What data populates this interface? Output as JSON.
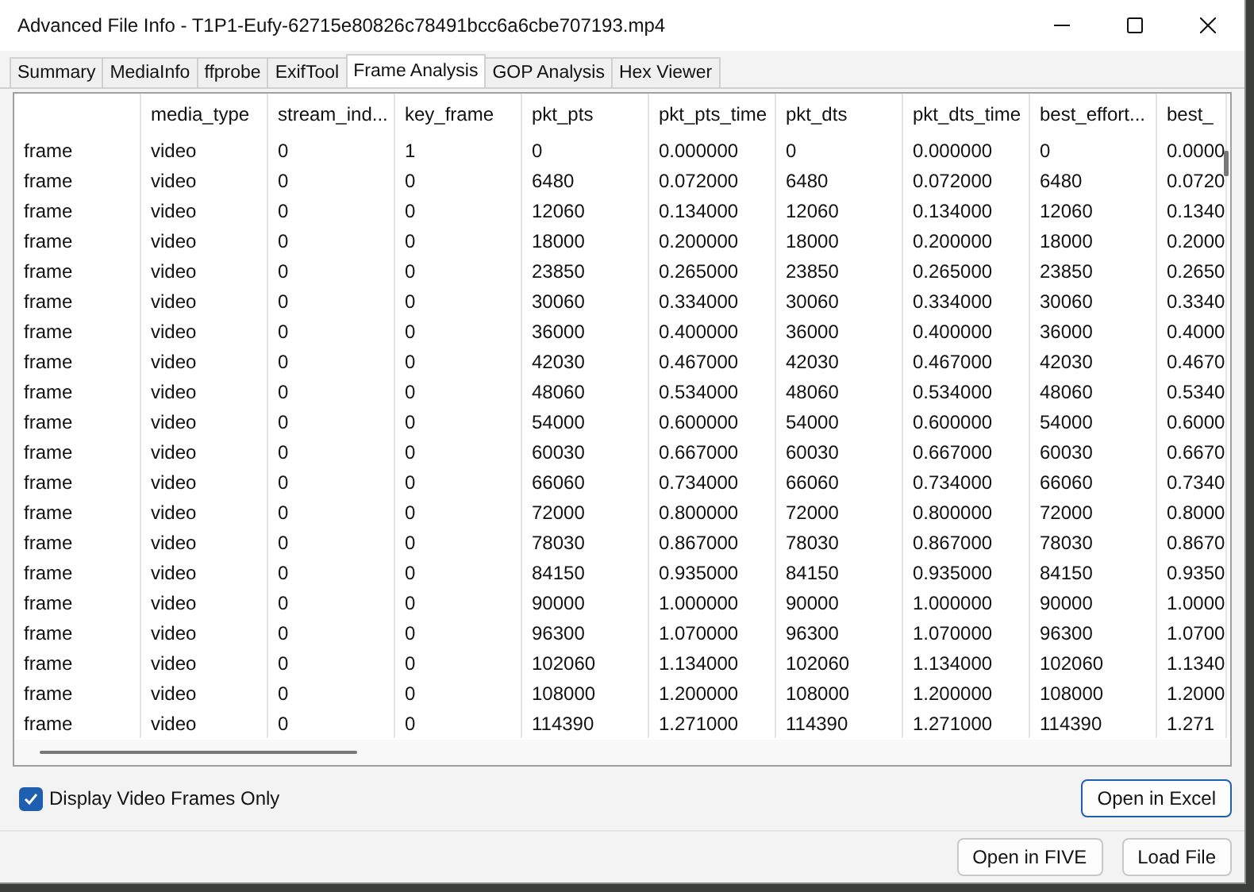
{
  "window": {
    "title": "Advanced File Info - T1P1-Eufy-62715e80826c78491bcc6a6cbe707193.mp4"
  },
  "tabs": [
    {
      "label": "Summary",
      "selected": false
    },
    {
      "label": "MediaInfo",
      "selected": false
    },
    {
      "label": "ffprobe",
      "selected": false
    },
    {
      "label": "ExifTool",
      "selected": false
    },
    {
      "label": "Frame Analysis",
      "selected": true
    },
    {
      "label": "GOP Analysis",
      "selected": false
    },
    {
      "label": "Hex Viewer",
      "selected": false
    }
  ],
  "table": {
    "columns": [
      "",
      "media_type",
      "stream_ind...",
      "key_frame",
      "pkt_pts",
      "pkt_pts_time",
      "pkt_dts",
      "pkt_dts_time",
      "best_effort...",
      "best_"
    ],
    "rows": [
      [
        "frame",
        "video",
        "0",
        "1",
        "0",
        "0.000000",
        "0",
        "0.000000",
        "0",
        "0.0000"
      ],
      [
        "frame",
        "video",
        "0",
        "0",
        "6480",
        "0.072000",
        "6480",
        "0.072000",
        "6480",
        "0.0720"
      ],
      [
        "frame",
        "video",
        "0",
        "0",
        "12060",
        "0.134000",
        "12060",
        "0.134000",
        "12060",
        "0.1340"
      ],
      [
        "frame",
        "video",
        "0",
        "0",
        "18000",
        "0.200000",
        "18000",
        "0.200000",
        "18000",
        "0.2000"
      ],
      [
        "frame",
        "video",
        "0",
        "0",
        "23850",
        "0.265000",
        "23850",
        "0.265000",
        "23850",
        "0.2650"
      ],
      [
        "frame",
        "video",
        "0",
        "0",
        "30060",
        "0.334000",
        "30060",
        "0.334000",
        "30060",
        "0.3340"
      ],
      [
        "frame",
        "video",
        "0",
        "0",
        "36000",
        "0.400000",
        "36000",
        "0.400000",
        "36000",
        "0.4000"
      ],
      [
        "frame",
        "video",
        "0",
        "0",
        "42030",
        "0.467000",
        "42030",
        "0.467000",
        "42030",
        "0.4670"
      ],
      [
        "frame",
        "video",
        "0",
        "0",
        "48060",
        "0.534000",
        "48060",
        "0.534000",
        "48060",
        "0.5340"
      ],
      [
        "frame",
        "video",
        "0",
        "0",
        "54000",
        "0.600000",
        "54000",
        "0.600000",
        "54000",
        "0.6000"
      ],
      [
        "frame",
        "video",
        "0",
        "0",
        "60030",
        "0.667000",
        "60030",
        "0.667000",
        "60030",
        "0.6670"
      ],
      [
        "frame",
        "video",
        "0",
        "0",
        "66060",
        "0.734000",
        "66060",
        "0.734000",
        "66060",
        "0.7340"
      ],
      [
        "frame",
        "video",
        "0",
        "0",
        "72000",
        "0.800000",
        "72000",
        "0.800000",
        "72000",
        "0.8000"
      ],
      [
        "frame",
        "video",
        "0",
        "0",
        "78030",
        "0.867000",
        "78030",
        "0.867000",
        "78030",
        "0.8670"
      ],
      [
        "frame",
        "video",
        "0",
        "0",
        "84150",
        "0.935000",
        "84150",
        "0.935000",
        "84150",
        "0.9350"
      ],
      [
        "frame",
        "video",
        "0",
        "0",
        "90000",
        "1.000000",
        "90000",
        "1.000000",
        "90000",
        "1.0000"
      ],
      [
        "frame",
        "video",
        "0",
        "0",
        "96300",
        "1.070000",
        "96300",
        "1.070000",
        "96300",
        "1.0700"
      ],
      [
        "frame",
        "video",
        "0",
        "0",
        "102060",
        "1.134000",
        "102060",
        "1.134000",
        "102060",
        "1.1340"
      ],
      [
        "frame",
        "video",
        "0",
        "0",
        "108000",
        "1.200000",
        "108000",
        "1.200000",
        "108000",
        "1.2000"
      ],
      [
        "frame",
        "video",
        "0",
        "0",
        "114390",
        "1.271000",
        "114390",
        "1.271000",
        "114390",
        "1.271"
      ]
    ]
  },
  "display_video_frames_only": {
    "label": "Display Video Frames Only",
    "checked": true
  },
  "buttons": [
    "Open in Excel",
    "Open in FIVE",
    "Load File"
  ]
}
